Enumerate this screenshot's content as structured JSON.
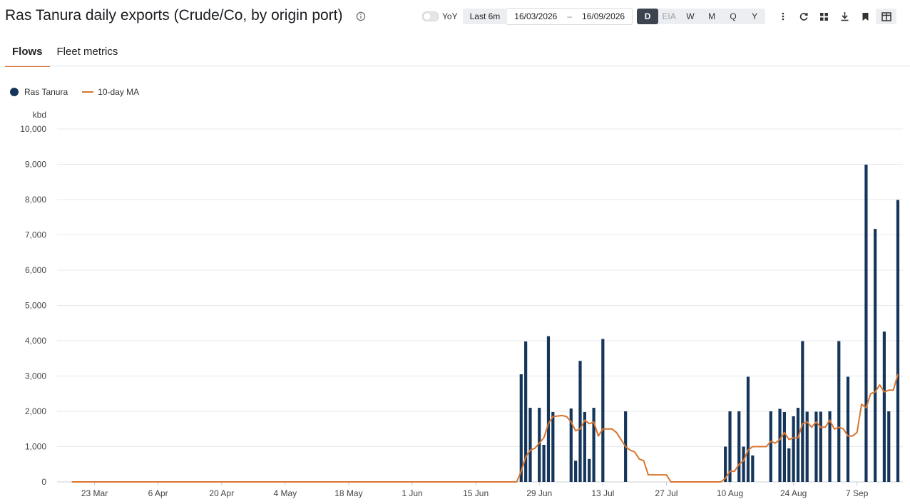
{
  "header": {
    "title": "Ras Tanura daily exports (Crude/Co, by origin port)",
    "yoy_label": "YoY",
    "range_label": "Last 6m",
    "date_from": "16/03/2026",
    "date_sep": "–",
    "date_to": "16/09/2026",
    "frequencies": [
      "D",
      "EIA",
      "W",
      "M",
      "Q",
      "Y"
    ],
    "active_frequency": "D",
    "icons": [
      "more-vertical-icon",
      "refresh-icon",
      "grid-icon",
      "download-icon",
      "bookmark-icon",
      "panel-icon"
    ]
  },
  "tabs": [
    {
      "label": "Flows",
      "active": true
    },
    {
      "label": "Fleet metrics",
      "active": false
    }
  ],
  "colors": {
    "bar": "#15365a",
    "ma": "#d9752f",
    "accent": "#e0682a"
  },
  "chart_data": {
    "type": "bar",
    "ylabel": "kbd",
    "ylim": [
      0,
      10000
    ],
    "yticks": [
      0,
      1000,
      2000,
      3000,
      4000,
      5000,
      6000,
      7000,
      8000,
      9000,
      10000
    ],
    "yticklabels": [
      "0",
      "1,000",
      "2,000",
      "3,000",
      "4,000",
      "5,000",
      "6,000",
      "7,000",
      "8,000",
      "9,000",
      "10,000"
    ],
    "xlim": [
      "2026-03-16",
      "2026-09-16"
    ],
    "xticks": [
      "2026-03-23",
      "2026-04-06",
      "2026-04-20",
      "2026-05-04",
      "2026-05-18",
      "2026-06-01",
      "2026-06-15",
      "2026-06-29",
      "2026-07-13",
      "2026-07-27",
      "2026-08-10",
      "2026-08-24",
      "2026-09-07"
    ],
    "xticklabels": [
      "23 Mar",
      "6 Apr",
      "20 Apr",
      "4 May",
      "18 May",
      "1 Jun",
      "15 Jun",
      "29 Jun",
      "13 Jul",
      "27 Jul",
      "10 Aug",
      "24 Aug",
      "7 Sep"
    ],
    "legend_position": "top-left",
    "grid": true,
    "series": [
      {
        "name": "Ras Tanura",
        "kind": "bar",
        "points": [
          [
            "2026-06-25",
            3050
          ],
          [
            "2026-06-26",
            3980
          ],
          [
            "2026-06-27",
            2100
          ],
          [
            "2026-06-29",
            2100
          ],
          [
            "2026-06-30",
            1050
          ],
          [
            "2026-07-01",
            4130
          ],
          [
            "2026-07-02",
            1980
          ],
          [
            "2026-07-06",
            2080
          ],
          [
            "2026-07-07",
            600
          ],
          [
            "2026-07-08",
            3430
          ],
          [
            "2026-07-09",
            1980
          ],
          [
            "2026-07-10",
            650
          ],
          [
            "2026-07-11",
            2100
          ],
          [
            "2026-07-13",
            4050
          ],
          [
            "2026-07-18",
            2000
          ],
          [
            "2026-08-09",
            1000
          ],
          [
            "2026-08-10",
            2000
          ],
          [
            "2026-08-12",
            2000
          ],
          [
            "2026-08-13",
            1000
          ],
          [
            "2026-08-14",
            2980
          ],
          [
            "2026-08-15",
            750
          ],
          [
            "2026-08-19",
            2000
          ],
          [
            "2026-08-21",
            2070
          ],
          [
            "2026-08-22",
            1980
          ],
          [
            "2026-08-23",
            950
          ],
          [
            "2026-08-24",
            1860
          ],
          [
            "2026-08-25",
            2100
          ],
          [
            "2026-08-26",
            3990
          ],
          [
            "2026-08-27",
            1990
          ],
          [
            "2026-08-29",
            1990
          ],
          [
            "2026-08-30",
            1990
          ],
          [
            "2026-09-01",
            2000
          ],
          [
            "2026-09-03",
            3990
          ],
          [
            "2026-09-05",
            2980
          ],
          [
            "2026-09-09",
            8990
          ],
          [
            "2026-09-11",
            7170
          ],
          [
            "2026-09-13",
            4260
          ],
          [
            "2026-09-14",
            2000
          ],
          [
            "2026-09-16",
            7990
          ]
        ]
      },
      {
        "name": "10-day MA",
        "kind": "line",
        "points": [
          [
            "2026-03-18",
            0
          ],
          [
            "2026-06-24",
            0
          ],
          [
            "2026-06-25",
            300
          ],
          [
            "2026-06-26",
            700
          ],
          [
            "2026-06-27",
            900
          ],
          [
            "2026-06-28",
            950
          ],
          [
            "2026-06-29",
            1100
          ],
          [
            "2026-06-30",
            1250
          ],
          [
            "2026-07-01",
            1650
          ],
          [
            "2026-07-02",
            1850
          ],
          [
            "2026-07-04",
            1880
          ],
          [
            "2026-07-05",
            1850
          ],
          [
            "2026-07-06",
            1700
          ],
          [
            "2026-07-07",
            1450
          ],
          [
            "2026-07-08",
            1500
          ],
          [
            "2026-07-09",
            1750
          ],
          [
            "2026-07-10",
            1650
          ],
          [
            "2026-07-11",
            1700
          ],
          [
            "2026-07-12",
            1300
          ],
          [
            "2026-07-13",
            1500
          ],
          [
            "2026-07-15",
            1500
          ],
          [
            "2026-07-16",
            1400
          ],
          [
            "2026-07-17",
            1200
          ],
          [
            "2026-07-18",
            1000
          ],
          [
            "2026-07-19",
            900
          ],
          [
            "2026-07-20",
            850
          ],
          [
            "2026-07-21",
            650
          ],
          [
            "2026-07-22",
            600
          ],
          [
            "2026-07-23",
            200
          ],
          [
            "2026-07-27",
            200
          ],
          [
            "2026-07-28",
            0
          ],
          [
            "2026-08-08",
            0
          ],
          [
            "2026-08-09",
            100
          ],
          [
            "2026-08-10",
            300
          ],
          [
            "2026-08-11",
            300
          ],
          [
            "2026-08-12",
            500
          ],
          [
            "2026-08-13",
            600
          ],
          [
            "2026-08-14",
            900
          ],
          [
            "2026-08-15",
            1000
          ],
          [
            "2026-08-18",
            1000
          ],
          [
            "2026-08-19",
            1150
          ],
          [
            "2026-08-20",
            1100
          ],
          [
            "2026-08-21",
            1200
          ],
          [
            "2026-08-22",
            1400
          ],
          [
            "2026-08-23",
            1200
          ],
          [
            "2026-08-24",
            1250
          ],
          [
            "2026-08-25",
            1250
          ],
          [
            "2026-08-26",
            1650
          ],
          [
            "2026-08-27",
            1700
          ],
          [
            "2026-08-28",
            1550
          ],
          [
            "2026-08-29",
            1700
          ],
          [
            "2026-08-30",
            1550
          ],
          [
            "2026-08-31",
            1550
          ],
          [
            "2026-09-01",
            1750
          ],
          [
            "2026-09-02",
            1500
          ],
          [
            "2026-09-03",
            1550
          ],
          [
            "2026-09-04",
            1500
          ],
          [
            "2026-09-05",
            1300
          ],
          [
            "2026-09-06",
            1300
          ],
          [
            "2026-09-07",
            1400
          ],
          [
            "2026-09-08",
            2200
          ],
          [
            "2026-09-09",
            2100
          ],
          [
            "2026-09-10",
            2500
          ],
          [
            "2026-09-11",
            2550
          ],
          [
            "2026-09-12",
            2750
          ],
          [
            "2026-09-13",
            2550
          ],
          [
            "2026-09-14",
            2600
          ],
          [
            "2026-09-15",
            2600
          ],
          [
            "2026-09-16",
            3050
          ]
        ]
      }
    ]
  }
}
